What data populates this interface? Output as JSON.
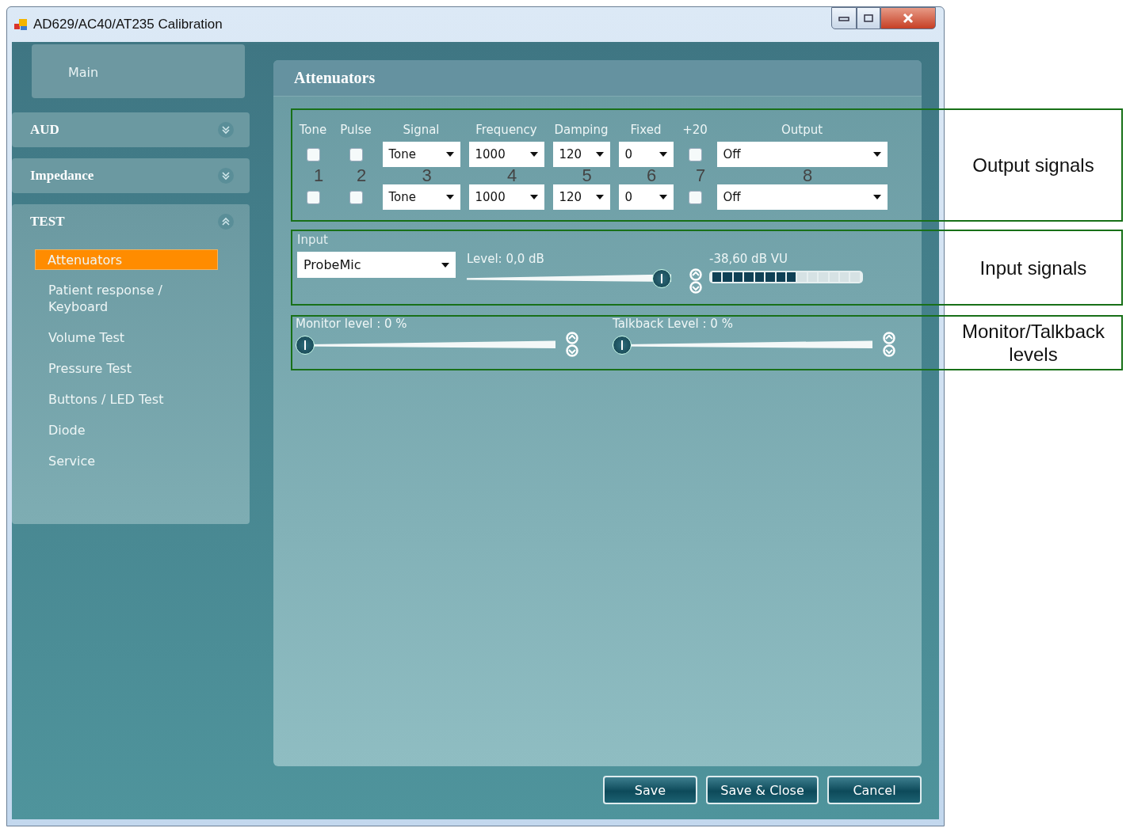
{
  "window": {
    "title": "AD629/AC40/AT235 Calibration"
  },
  "sidebar": {
    "main_label": "Main",
    "sections": [
      {
        "label": "AUD",
        "expanded": false
      },
      {
        "label": "Impedance",
        "expanded": false
      },
      {
        "label": "TEST",
        "expanded": true,
        "items": [
          {
            "label": "Attenuators",
            "selected": true
          },
          {
            "label": "Patient response / Keyboard",
            "selected": false
          },
          {
            "label": "Volume Test",
            "selected": false
          },
          {
            "label": "Pressure Test",
            "selected": false
          },
          {
            "label": "Buttons / LED Test",
            "selected": false
          },
          {
            "label": "Diode",
            "selected": false
          },
          {
            "label": "Service",
            "selected": false
          }
        ]
      }
    ]
  },
  "panel": {
    "title": "Attenuators",
    "output": {
      "columns": [
        "Tone",
        "Pulse",
        "Signal",
        "Frequency",
        "Damping",
        "Fixed",
        "+20",
        "Output"
      ],
      "rows": [
        {
          "tone": false,
          "pulse": false,
          "signal": "Tone",
          "frequency": "1000",
          "damping": "120",
          "fixed": "0",
          "plus20": false,
          "output": "Off"
        },
        {
          "tone": false,
          "pulse": false,
          "signal": "Tone",
          "frequency": "1000",
          "damping": "120",
          "fixed": "0",
          "plus20": false,
          "output": "Off"
        }
      ]
    },
    "input": {
      "label": "Input",
      "source": "ProbeMic",
      "level_label": "Level: 0,0 dB",
      "slider": {
        "level": 1
      },
      "vu": {
        "label": "-38,60 dB VU",
        "level": 0.57
      }
    },
    "monitor": {
      "label": "Monitor level : 0 %",
      "level": 0
    },
    "talkback": {
      "label": "Talkback Level : 0 %",
      "level": 0
    }
  },
  "buttons": [
    "Save",
    "Save & Close",
    "Cancel"
  ],
  "annotations": {
    "column_numbers": [
      "1",
      "2",
      "3",
      "4",
      "5",
      "6",
      "7",
      "8"
    ],
    "callouts": [
      "Output signals",
      "Input signals",
      "Monitor/Talkback levels"
    ]
  }
}
